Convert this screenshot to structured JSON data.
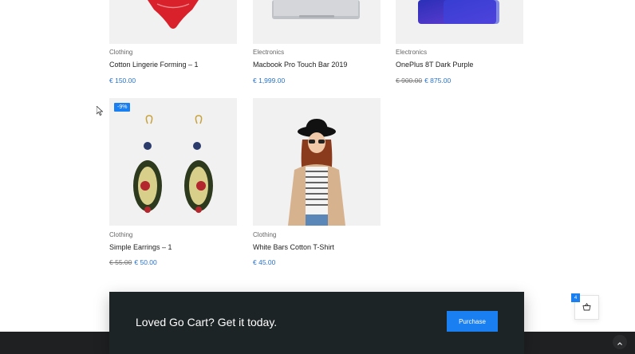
{
  "products": [
    {
      "category": "Clothing",
      "name": "Cotton Lingerie Forming – 1",
      "price": "€ 150.00",
      "old_price": ""
    },
    {
      "category": "Electronics",
      "name": "Macbook Pro Touch Bar 2019",
      "price": "€ 1,999.00",
      "old_price": ""
    },
    {
      "category": "Electronics",
      "name": "OnePlus 8T Dark Purple",
      "price": "€ 875.00",
      "old_price": "€ 900.00"
    },
    {
      "category": "Clothing",
      "name": "Simple Earrings – 1",
      "price": "€ 50.00",
      "old_price": "€ 55.00",
      "badge": "-9%"
    },
    {
      "category": "Clothing",
      "name": "White Bars Cotton T-Shirt",
      "price": "€ 45.00",
      "old_price": ""
    }
  ],
  "banner": {
    "text": "Loved Go Cart? Get it today.",
    "button": "Purchase"
  },
  "cart": {
    "count": "4",
    "icon": "basket-icon"
  },
  "scroll_top": {
    "icon": "chevron-up-icon"
  },
  "colors": {
    "accent": "#1a7ff0",
    "price": "#2b73c9",
    "banner_bg": "#1d2426",
    "footer_bg": "#1e2022"
  }
}
